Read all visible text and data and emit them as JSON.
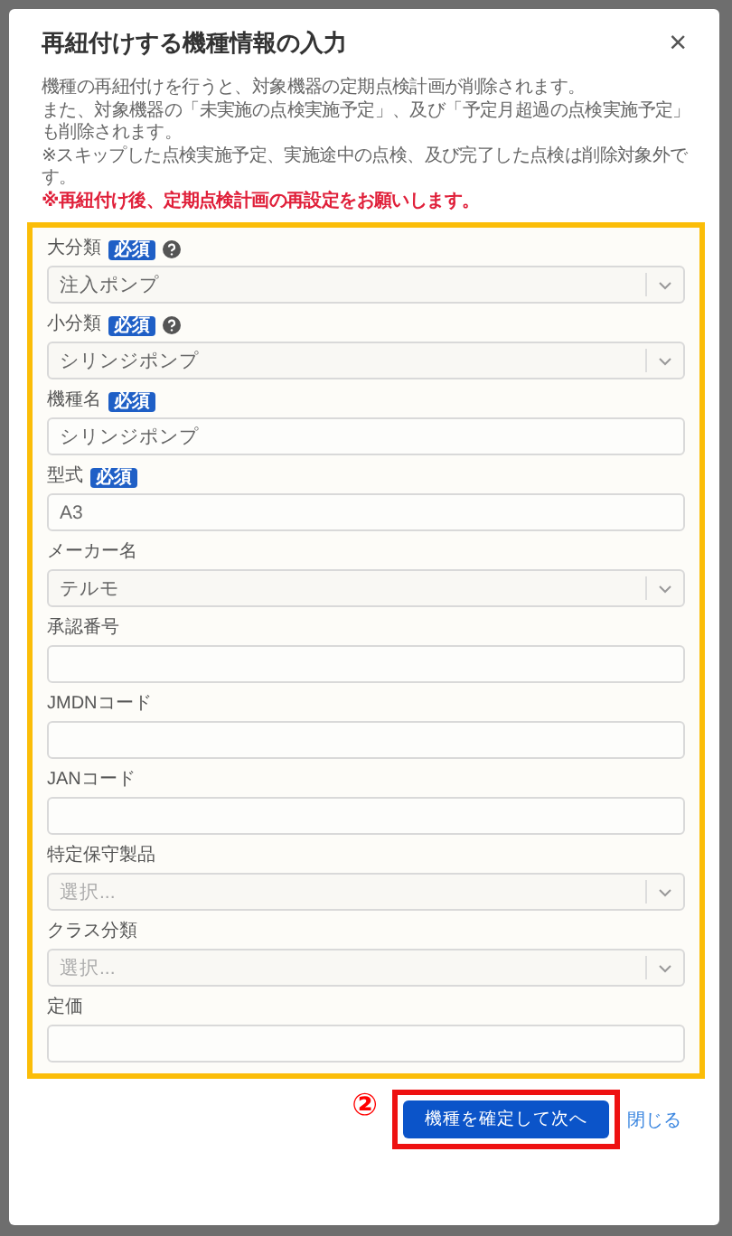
{
  "dialog": {
    "title": "再紐付けする機種情報の入力",
    "close_glyph": "×",
    "notes": [
      {
        "kind": "normal",
        "text": "機種の再紐付けを行うと、対象機器の定期点検計画が削除されます。"
      },
      {
        "kind": "normal",
        "text": "また、対象機器の「未実施の点検実施予定」、及び「予定月超過の点検実施予定」も削除されます。"
      },
      {
        "kind": "normal",
        "text": "※スキップした点検実施予定、実施途中の点検、及び完了した点検は削除対象外です。"
      },
      {
        "kind": "warning",
        "text": "※再紐付け後、定期点検計画の再設定をお願いします。"
      }
    ],
    "fields": [
      {
        "label": "大分類",
        "badge": "必須",
        "help": true,
        "kind": "select",
        "value": "注入ポンプ"
      },
      {
        "label": "小分類",
        "badge": "必須",
        "help": true,
        "kind": "select",
        "value": "シリンジポンプ"
      },
      {
        "label": "機種名",
        "badge": "必須",
        "kind": "text",
        "value": "シリンジポンプ"
      },
      {
        "label": "型式",
        "badge": "必須",
        "kind": "text",
        "value": "A3"
      },
      {
        "label": "メーカー名",
        "kind": "select",
        "value": "テルモ"
      },
      {
        "label": "承認番号",
        "kind": "text"
      },
      {
        "label": "JMDNコード",
        "kind": "text"
      },
      {
        "label": "JANコード",
        "kind": "text"
      },
      {
        "label": "特定保守製品",
        "kind": "select",
        "placeholder": "選択..."
      },
      {
        "label": "クラス分類",
        "kind": "select",
        "placeholder": "選択..."
      },
      {
        "label": "定価",
        "kind": "text"
      }
    ],
    "primary_button": "機種を確定して次へ",
    "close_link": "閉じる",
    "step_marker": "②"
  }
}
